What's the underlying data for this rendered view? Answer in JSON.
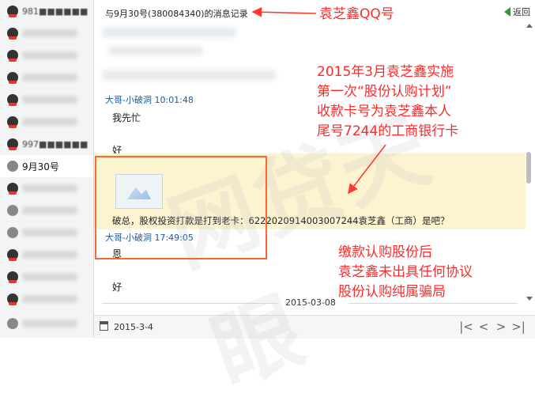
{
  "sidebar": {
    "contacts": [
      {
        "name": "981■■■■■■",
        "active": false
      },
      {
        "name": "",
        "active": false
      },
      {
        "name": "",
        "active": false
      },
      {
        "name": "",
        "active": false
      },
      {
        "name": "",
        "active": false
      },
      {
        "name": "",
        "active": false
      },
      {
        "name": "997■■■■■■",
        "active": false
      },
      {
        "name": "9月30号",
        "active": true
      },
      {
        "name": "",
        "active": false
      },
      {
        "name": "",
        "active": false
      },
      {
        "name": "",
        "active": false
      },
      {
        "name": "",
        "active": false
      },
      {
        "name": "",
        "active": false
      },
      {
        "name": "",
        "active": false
      },
      {
        "name": "",
        "active": false
      }
    ]
  },
  "header": {
    "title": "与9月30号(380084340)的消息记录",
    "back_label": "返回"
  },
  "messages": [
    {
      "sender": "大哥-小破洞 10:01:48",
      "text": "我先忙"
    },
    {
      "text": "好"
    },
    {
      "text": "破总，股权投资打款是打到老卡：6222020914003007244袁芝鑫（工商）是吧？"
    },
    {
      "sender": "大哥-小破洞 17:49:05",
      "text": "恩"
    },
    {
      "text": "好"
    }
  ],
  "date_separator": "2015-03-08",
  "footer": {
    "date": "2015-3-4",
    "nav": [
      "|<",
      "<",
      ">",
      ">|"
    ]
  },
  "annotations": {
    "qq_label": "袁芝鑫QQ号",
    "note1": [
      "2015年3月袁芝鑫实施",
      "第一次“股份认购计划”",
      "收款卡号为袁芝鑫本人",
      "尾号7244的工商银行卡"
    ],
    "note2": [
      "缴款认购股份后",
      "袁芝鑫未出具任何协议",
      "股份认购纯属骗局"
    ],
    "color": "#ff2a2a"
  },
  "watermark": "网贷天眼"
}
